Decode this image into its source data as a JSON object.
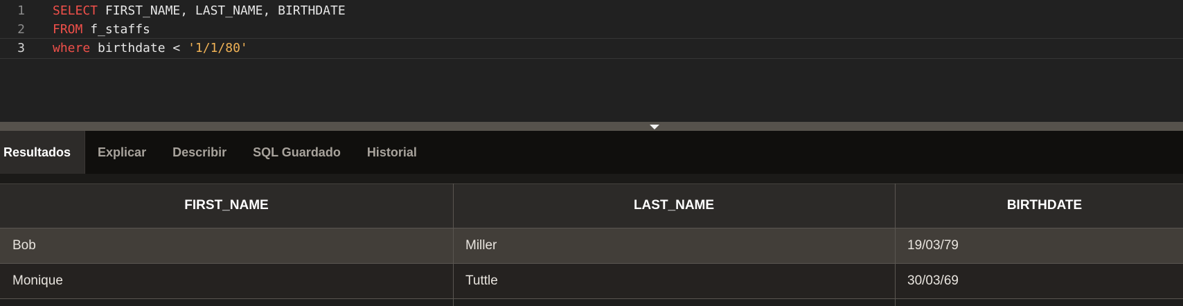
{
  "editor": {
    "lines": [
      {
        "number": "1",
        "tokens": [
          {
            "text": "SELECT",
            "type": "kw"
          },
          {
            "text": " FIRST_NAME, LAST_NAME, BIRTHDATE",
            "type": "plain"
          }
        ]
      },
      {
        "number": "2",
        "tokens": [
          {
            "text": "FROM",
            "type": "kw"
          },
          {
            "text": " f_staffs",
            "type": "plain"
          }
        ]
      },
      {
        "number": "3",
        "tokens": [
          {
            "text": "where",
            "type": "kw"
          },
          {
            "text": " birthdate < ",
            "type": "plain"
          },
          {
            "text": "'1/1/80'",
            "type": "str"
          }
        ]
      }
    ]
  },
  "splitter": {
    "icon": "collapse-down-icon"
  },
  "tabs": [
    {
      "label": "Resultados",
      "active": true
    },
    {
      "label": "Explicar",
      "active": false
    },
    {
      "label": "Describir",
      "active": false
    },
    {
      "label": "SQL Guardado",
      "active": false
    },
    {
      "label": "Historial",
      "active": false
    }
  ],
  "results": {
    "columns": [
      "FIRST_NAME",
      "LAST_NAME",
      "BIRTHDATE"
    ],
    "rows": [
      [
        "Bob",
        "Miller",
        "19/03/79"
      ],
      [
        "Monique",
        "Tuttle",
        "30/03/69"
      ]
    ]
  },
  "colors": {
    "keyword": "#f0504a",
    "string": "#f0b256",
    "editor_bg": "#212121",
    "tabs_bg": "#100f0d",
    "selected_row": "#423e39"
  }
}
